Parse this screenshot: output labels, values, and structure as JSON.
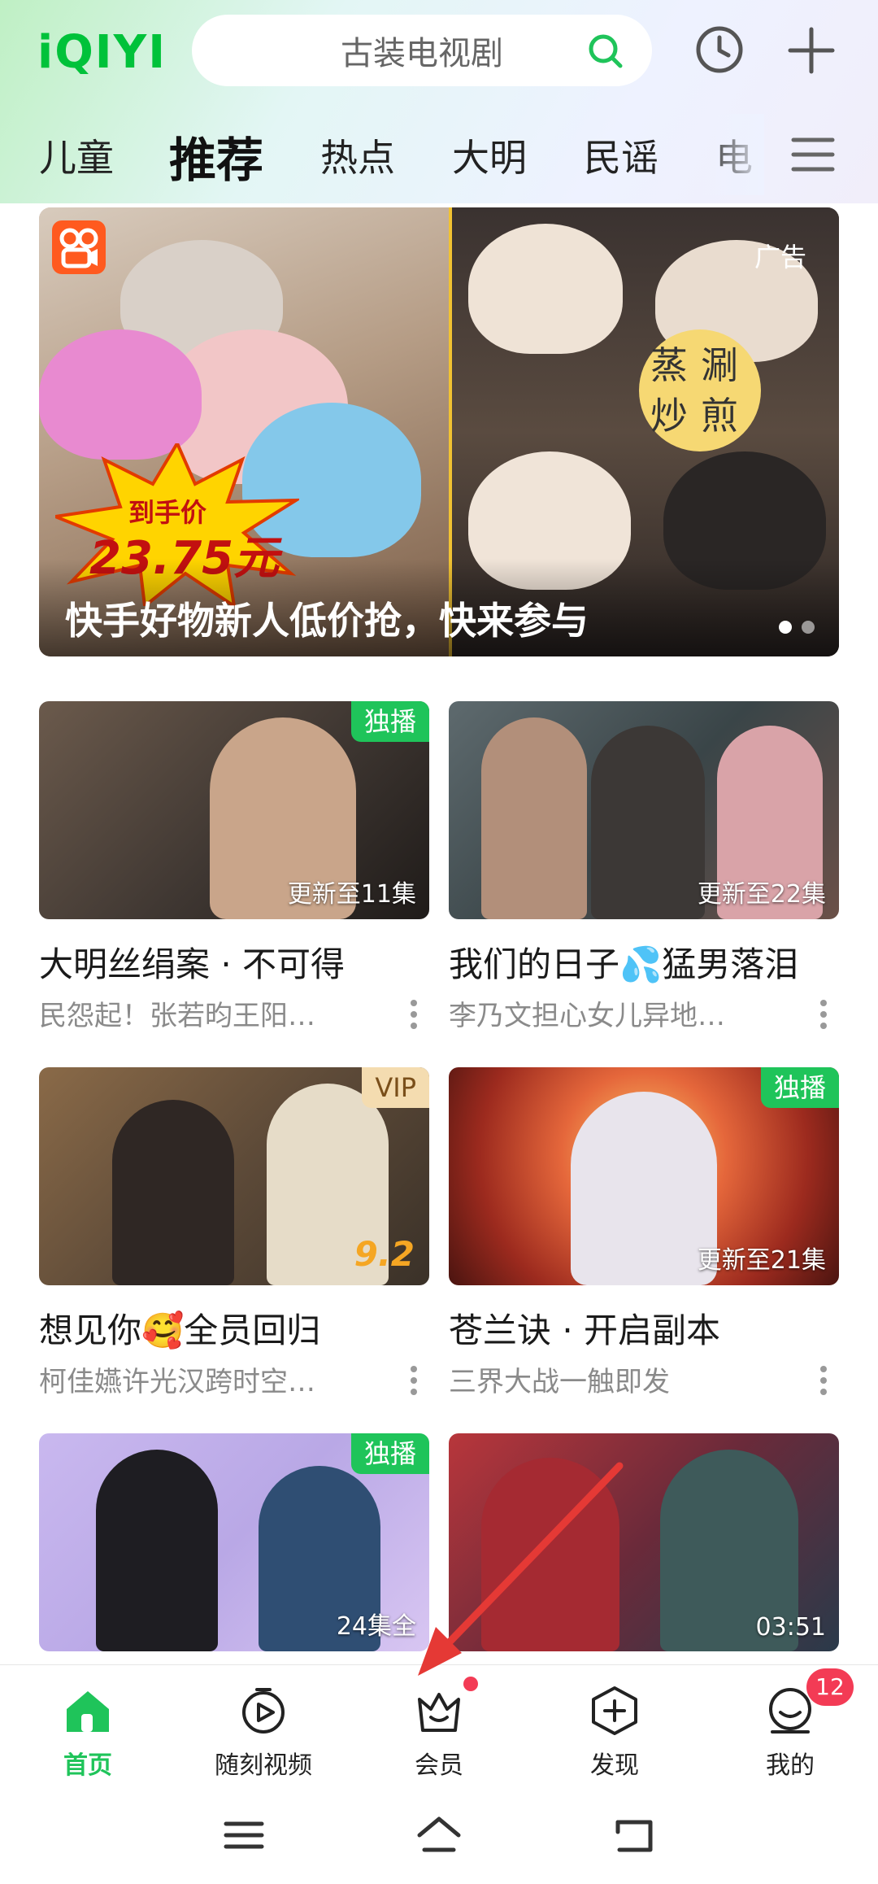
{
  "header": {
    "logo": "iQIYI",
    "search_placeholder": "古装电视剧",
    "search_icon": "search-icon",
    "history_icon": "history-clock-icon",
    "add_icon": "plus-icon"
  },
  "tabs": [
    "儿童",
    "推荐",
    "热点",
    "大明",
    "民谣",
    "电"
  ],
  "active_tab": "推荐",
  "banner": {
    "title": "快手好物新人低价抢，快来参与",
    "ad_label": "广告",
    "price_label": "到手价",
    "price": "23.75元",
    "slogan": "蒸涮炒煎",
    "page_dots": 2,
    "active_dot": 0
  },
  "cards": [
    {
      "title": "大明丝绢案 · 不可得",
      "subtitle": "民怨起！张若昀王阳…",
      "badge": "独播",
      "badge_type": "green",
      "update": "更新至11集"
    },
    {
      "title": "我们的日子💦猛男落泪",
      "subtitle": "李乃文担心女儿异地…",
      "badge": "",
      "badge_type": "",
      "update": "更新至22集"
    },
    {
      "title": "想见你🥰全员回归",
      "subtitle": "柯佳嬿许光汉跨时空…",
      "badge": "VIP",
      "badge_type": "vip",
      "update": "",
      "score": "9.2"
    },
    {
      "title": "苍兰诀 · 开启副本",
      "subtitle": "三界大战一触即发",
      "badge": "独播",
      "badge_type": "green",
      "update": "更新至21集"
    },
    {
      "title": "",
      "subtitle": "",
      "badge": "独播",
      "badge_type": "green",
      "update": "24集全"
    },
    {
      "title": "",
      "subtitle": "",
      "badge": "",
      "badge_type": "",
      "update": "03:51"
    }
  ],
  "nav": {
    "items": [
      {
        "label": "首页",
        "icon": "home-icon",
        "active": true
      },
      {
        "label": "随刻视频",
        "icon": "suike-video-icon",
        "active": false
      },
      {
        "label": "会员",
        "icon": "vip-crown-icon",
        "active": false
      },
      {
        "label": "发现",
        "icon": "discover-icon",
        "active": false
      },
      {
        "label": "我的",
        "icon": "profile-icon",
        "active": false
      }
    ],
    "profile_badge": "12"
  },
  "colors": {
    "brand_green": "#1fc45a",
    "badge_red": "#f33b55",
    "annotation_arrow": "#e53935"
  }
}
